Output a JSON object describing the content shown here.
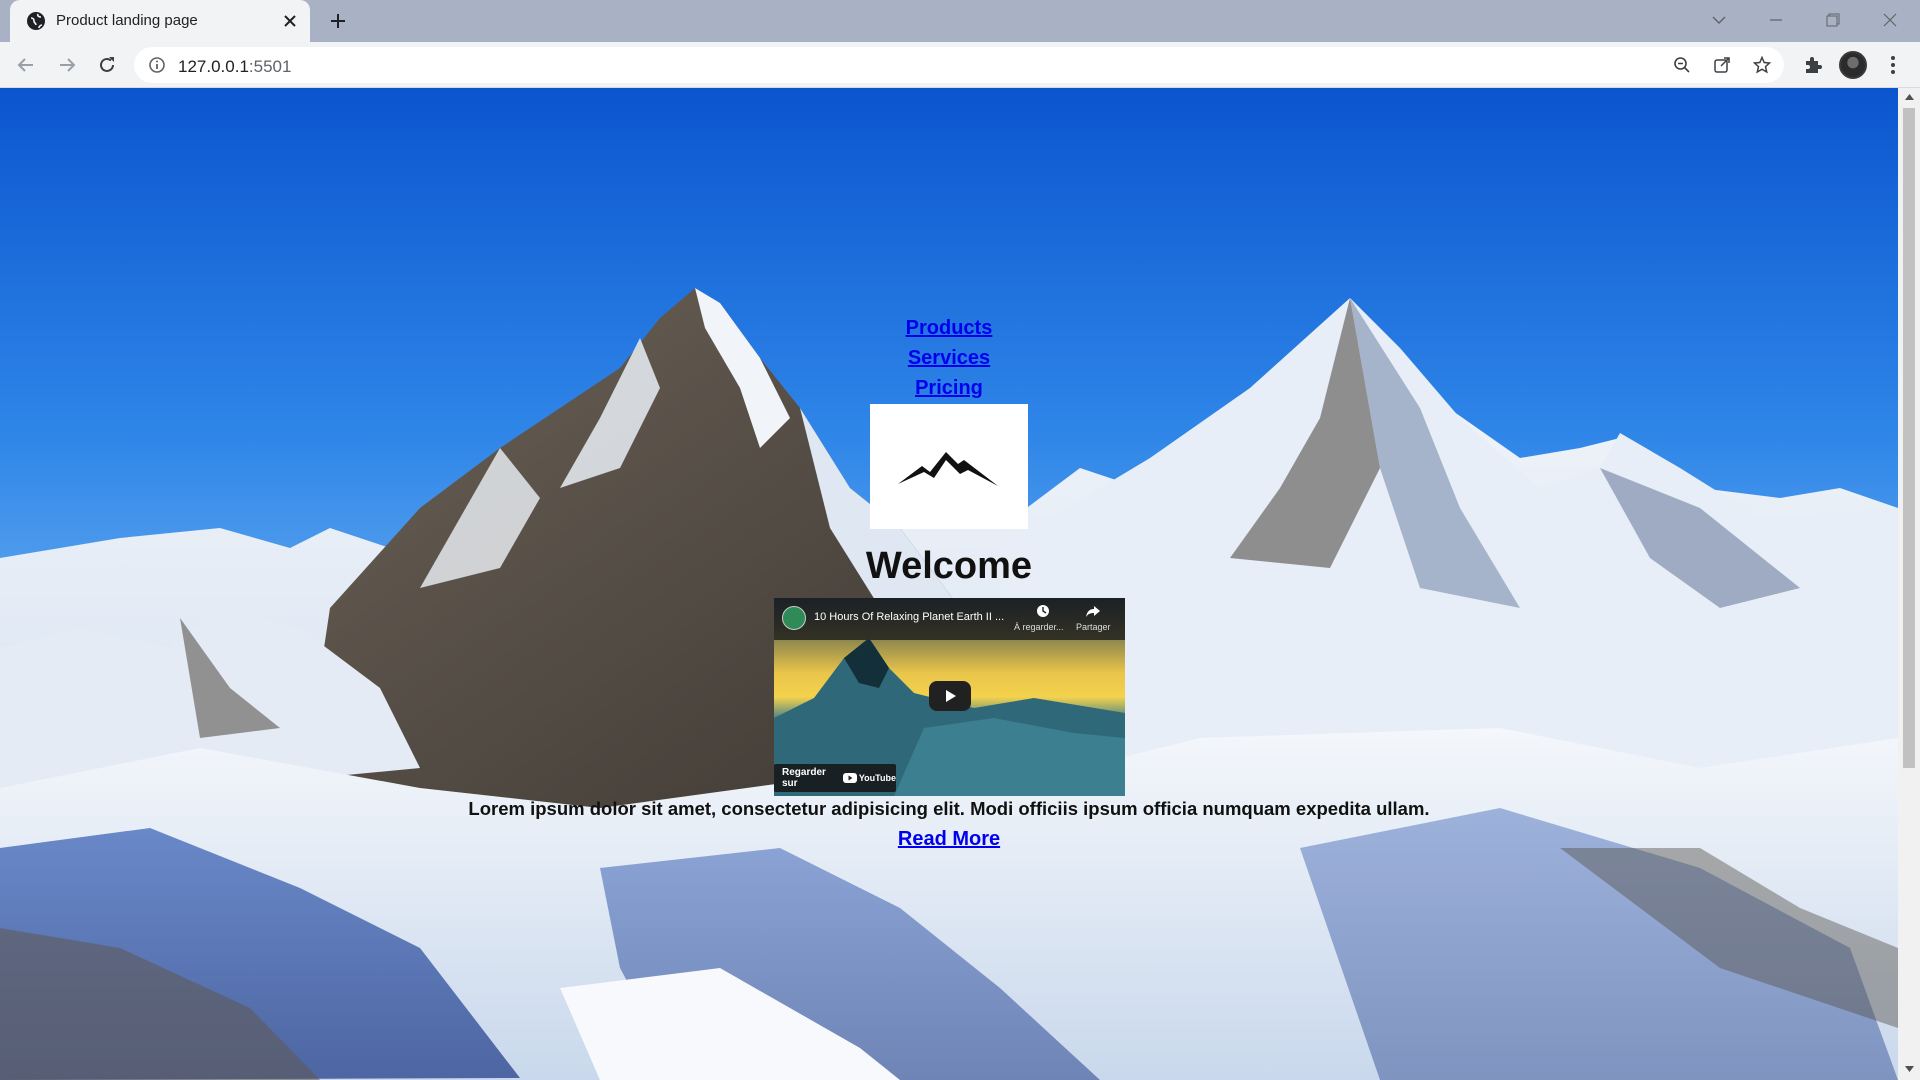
{
  "browser": {
    "tab_title": "Product landing page",
    "url_host": "127.0.0.1",
    "url_port": ":5501",
    "icons": [
      "globe-icon",
      "close-icon",
      "plus-icon",
      "back-icon",
      "forward-icon",
      "reload-icon",
      "info-icon",
      "zoom-out-icon",
      "share-icon",
      "star-icon",
      "extensions-icon",
      "avatar",
      "menu-icon"
    ]
  },
  "nav": {
    "links": [
      "Products",
      "Services",
      "Pricing"
    ]
  },
  "hero": {
    "heading": "Welcome",
    "text": "Lorem ipsum dolor sit amet, consectetur adipisicing elit. Modi officiis ipsum officia numquam expedita ullam.",
    "read_more": "Read More"
  },
  "video": {
    "title": "10 Hours Of Relaxing Planet Earth II ...",
    "watch_later": "À regarder...",
    "share": "Partager",
    "watch_on": "Regarder sur",
    "brand": "YouTube"
  },
  "colors": {
    "link": "#0000ee",
    "sky_top": "#0b5fd8",
    "sky_bottom": "#5aa3ee"
  }
}
